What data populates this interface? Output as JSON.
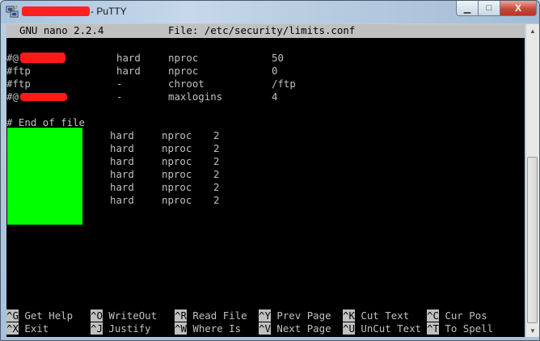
{
  "window": {
    "title": "- PuTTY",
    "controls": {
      "minimize": "▁",
      "maximize": "□",
      "close": "X"
    }
  },
  "nano": {
    "version": "GNU nano 2.2.4",
    "file": "File: /etc/security/limits.conf"
  },
  "lines": [
    {
      "c1": "#@",
      "c2": "hard",
      "c3": "nproc",
      "c4": "50"
    },
    {
      "c1": "#ftp",
      "c2": "hard",
      "c3": "nproc",
      "c4": "0"
    },
    {
      "c1": "#ftp",
      "c2": "-",
      "c3": "chroot",
      "c4": "/ftp"
    },
    {
      "c1": "#@",
      "c2": "-",
      "c3": "maxlogins",
      "c4": "4"
    }
  ],
  "end_comment": "# End of file",
  "entries": [
    {
      "type": "hard",
      "item": "nproc",
      "value": "2"
    },
    {
      "type": "hard",
      "item": "nproc",
      "value": "2"
    },
    {
      "type": "hard",
      "item": "nproc",
      "value": "2"
    },
    {
      "type": "hard",
      "item": "nproc",
      "value": "2"
    },
    {
      "type": "hard",
      "item": "nproc",
      "value": "2"
    },
    {
      "type": "hard",
      "item": "nproc",
      "value": "2"
    }
  ],
  "shortcuts": [
    [
      {
        "key": "^G",
        "label": "Get Help"
      },
      {
        "key": "^O",
        "label": "WriteOut"
      },
      {
        "key": "^R",
        "label": "Read File"
      },
      {
        "key": "^Y",
        "label": "Prev Page"
      },
      {
        "key": "^K",
        "label": "Cut Text"
      },
      {
        "key": "^C",
        "label": "Cur Pos"
      }
    ],
    [
      {
        "key": "^X",
        "label": "Exit"
      },
      {
        "key": "^J",
        "label": "Justify"
      },
      {
        "key": "^W",
        "label": "Where Is"
      },
      {
        "key": "^V",
        "label": "Next Page"
      },
      {
        "key": "^U",
        "label": "UnCut Text"
      },
      {
        "key": "^T",
        "label": "To Spell"
      }
    ]
  ],
  "colors": {
    "terminal_bg": "#000000",
    "terminal_fg": "#c0c0c0",
    "redaction": "#ff1a1a",
    "highlight_box": "#00ff00"
  },
  "icons": {
    "app": "putty-icon",
    "scroll_up": "arrow-up-icon",
    "scroll_down": "arrow-down-icon"
  }
}
